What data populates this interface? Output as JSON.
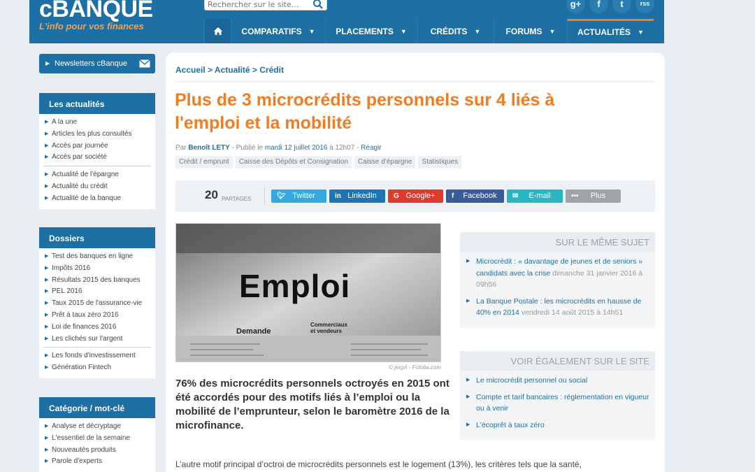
{
  "header": {
    "logo_title": "cBANQUE",
    "logo_tagline": "L'info pour vos finances",
    "search": {
      "placeholder": "Rechercher sur le site...",
      "value": ""
    },
    "social": [
      {
        "icon": "google-plus-icon",
        "glyph": "g+"
      },
      {
        "icon": "facebook-icon",
        "glyph": "f"
      },
      {
        "icon": "twitter-icon",
        "glyph": "t"
      },
      {
        "icon": "rss-icon",
        "glyph": "rss"
      }
    ],
    "nav": [
      {
        "label": "COMPARATIFS"
      },
      {
        "label": "PLACEMENTS"
      },
      {
        "label": "CRÉDITS"
      },
      {
        "label": "FORUMS"
      },
      {
        "label": "ACTUALITÉS",
        "active": true
      }
    ],
    "colors": {
      "brand_blue": "#1e6fa3",
      "accent_orange": "#f27c21"
    }
  },
  "sidebar": {
    "newsletter": "Newsletters cBanque",
    "actualites": {
      "title": "Les actualités",
      "group1": [
        "A la une",
        "Articles les plus consultés",
        "Accès par journée",
        "Accès par société"
      ],
      "group2": [
        "Actualité de l'épargne",
        "Actualité du crédit",
        "Actualité de la banque"
      ]
    },
    "dossiers": {
      "title": "Dossiers",
      "group1": [
        "Test des banques en ligne",
        "Impôts 2016",
        "Résultats 2015 des banques",
        "PEL 2016",
        "Taux 2015 de l'assurance-vie",
        "Prêt à taux zéro 2016",
        "Loi de finances 2016",
        "Les clichés sur l'argent"
      ],
      "group2": [
        "Les fonds d'investissement",
        "Génération Fintech"
      ]
    },
    "categorie": {
      "title": "Catégorie / mot-clé",
      "items": [
        "Analyse et décryptage",
        "L'essentiel de la semaine",
        "Nouveautés produits",
        "Parole d'experts"
      ]
    }
  },
  "article": {
    "breadcrumb": "Accueil > Actualité > Crédit",
    "title": "Plus de 3 microcrédits personnels sur 4 liés à l'emploi et la mobilité",
    "byline": {
      "prefix": "Par",
      "author": "Benoît LETY",
      "published": "- Publié le",
      "date": "mardi 12 juillet 2016",
      "time": "à 12h07 -",
      "reply": "Réagir"
    },
    "tags": [
      "Crédit / emprunt",
      "Caisse des Dépôts et Consignation",
      "Caisse d'épargne",
      "Statistiques"
    ],
    "share": {
      "count": "20",
      "count_label": "PARTAGES",
      "buttons": [
        {
          "label": "Twitter",
          "icon": "twitter-icon",
          "color": "#35a8e0"
        },
        {
          "label": "LinkedIn",
          "icon": "linkedin-icon",
          "color": "#1d75b5"
        },
        {
          "label": "Google+",
          "icon": "google-plus-icon",
          "color": "#dd3b2c"
        },
        {
          "label": "Facebook",
          "icon": "facebook-icon",
          "color": "#3b5a9a"
        },
        {
          "label": "E-mail",
          "icon": "email-icon",
          "color": "#29b5c2"
        },
        {
          "label": "Plus",
          "icon": "more-icon",
          "color": "#9fa4a8"
        }
      ]
    },
    "image": {
      "headline": "Emploi",
      "subhead_1": "Demande",
      "subhead_2": "Commerciaux et vendeurs",
      "credit": "© jergA - Fotolia.com"
    },
    "lede": "76% des microcrédits personnels octroyés en 2015 ont été accordés pour des motifs liés à l’emploi ou la mobilité de l’emprunteur, selon le baromètre 2016 de la microfinance.",
    "body": "L’autre motif principal d’octroi de microcrédits personnels est le logement (13%), les critères tels que la santé,"
  },
  "related": {
    "same_subject": {
      "title": "SUR LE MÊME SUJET",
      "items": [
        {
          "title": "Microcrédit : « davantage de jeunes et de seniors » candidats avec la crise",
          "meta": "dimanche 31 janvier 2016 à 09h56"
        },
        {
          "title": "La Banque Postale : les microcrédits en hausse de 40% en 2014",
          "meta": "vendredi 14 août 2015 à 14h51"
        }
      ]
    },
    "see_also": {
      "title": "VOIR ÉGALEMENT SUR LE SITE",
      "items": [
        {
          "title": "Le microcrédit personnel ou social"
        },
        {
          "title": "Compte et tarif bancaires : réglementation en vigueur ou à venir"
        },
        {
          "title": "L'écoprêt à taux zéro"
        }
      ]
    }
  }
}
